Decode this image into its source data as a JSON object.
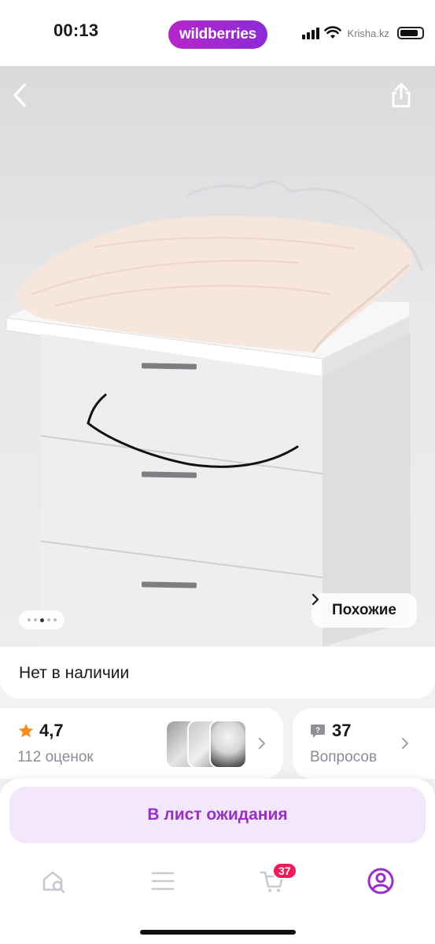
{
  "status_bar": {
    "time": "00:13",
    "brand": "wildberries",
    "watermark": "Krisha.kz"
  },
  "gallery": {
    "similar_label": "Похожие",
    "page_count": 5,
    "active_page": 2
  },
  "availability": {
    "text": "Нет в наличии"
  },
  "rating": {
    "value": "4,7",
    "count_label": "112 оценок"
  },
  "questions": {
    "count": "37",
    "label": "Вопросов"
  },
  "actions": {
    "wait_list_label": "В лист ожидания"
  },
  "tabbar": {
    "items": [
      {
        "name": "home",
        "icon": "home-search-icon"
      },
      {
        "name": "catalog",
        "icon": "menu-icon"
      },
      {
        "name": "cart",
        "icon": "cart-icon",
        "badge": "37"
      },
      {
        "name": "profile",
        "icon": "profile-icon"
      }
    ]
  },
  "colors": {
    "brand_start": "#b526c9",
    "brand_end": "#8c2bd9",
    "accent": "#9b2ccc",
    "badge": "#f5195c",
    "star": "#ff8c1a"
  }
}
